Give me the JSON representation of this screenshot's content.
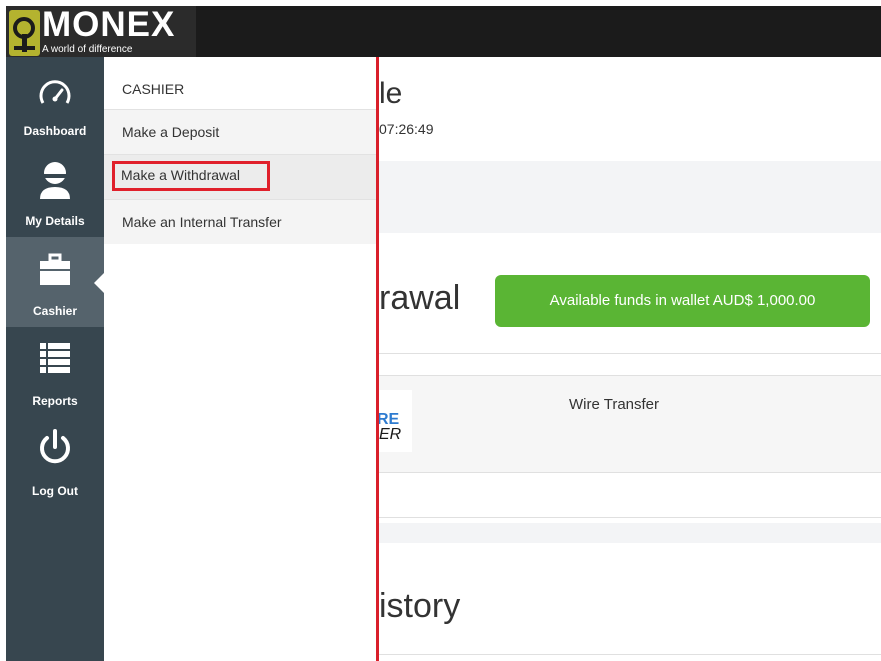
{
  "brand": {
    "name": "MONEX",
    "tagline": "A world of difference",
    "accent": "#b4b32f"
  },
  "sidebar": {
    "items": [
      {
        "label": "Dashboard",
        "icon": "speedometer-icon"
      },
      {
        "label": "My Details",
        "icon": "user-icon"
      },
      {
        "label": "Cashier",
        "icon": "briefcase-icon",
        "active": true
      },
      {
        "label": "Reports",
        "icon": "list-icon"
      },
      {
        "label": "Log Out",
        "icon": "power-icon"
      }
    ]
  },
  "cashier_menu": {
    "title": "CASHIER",
    "items": [
      {
        "label": "Make a Deposit"
      },
      {
        "label": "Make a Withdrawal",
        "highlighted": true
      },
      {
        "label": "Make an Internal Transfer"
      }
    ]
  },
  "main": {
    "title_fragment": "le",
    "time_fragment": "07:26:49",
    "withdrawal_heading_fragment": "rawal",
    "funds_badge": "Available funds in wallet AUD$ 1,000.00",
    "method": {
      "logo_line1": "RE",
      "logo_line2": "ER",
      "name": "Wire Transfer"
    },
    "history_heading_fragment": "istory"
  },
  "colors": {
    "sidebar_bg": "#37464f",
    "highlight_border": "#e0202b",
    "badge_green": "#5ab534"
  }
}
